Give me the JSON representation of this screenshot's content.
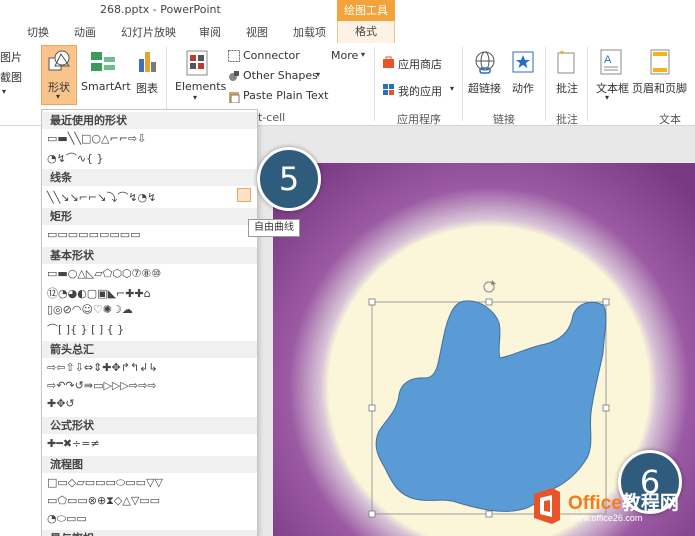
{
  "window": {
    "title": "268.pptx - PowerPoint",
    "contextual_tab_group": "绘图工具"
  },
  "tabs": [
    "切换",
    "动画",
    "幻灯片放映",
    "审阅",
    "视图",
    "加载项",
    "格式"
  ],
  "ribbon": {
    "picture_partial": "图片",
    "screenshot_partial": "截图",
    "shapes": "形状",
    "smartart": "SmartArt",
    "chart": "图表",
    "elements": "Elements",
    "connector": "Connector",
    "other_shapes": "Other Shapes",
    "paste_plain_text": "Paste Plain Text",
    "more": "More",
    "group_partial": "t-cell",
    "app_store": "应用商店",
    "my_apps": "我的应用",
    "apps_group": "应用程序",
    "hyperlink": "超链接",
    "action": "动作",
    "links_group": "链接",
    "comment": "批注",
    "comments_group": "批注",
    "textbox": "文本框",
    "header_footer": "页眉和页脚",
    "text_group": "文本"
  },
  "dropdown": {
    "sections": [
      {
        "name": "最近使用的形状",
        "rows": [
          "▭▬╲╲□○△⌐⌐⇨⇩",
          "◔↯⌒∿{ }"
        ]
      },
      {
        "name": "线条",
        "rows": [
          "╲╲↘↘⌐⌐↘⤵⌒↯◔↯"
        ]
      },
      {
        "name": "矩形",
        "rows": [
          "▭▭▭▭▭▭▭▭▭"
        ]
      },
      {
        "name": "基本形状",
        "rows": [
          "▭▬○△◺▱⬠⬡⬡⑦⑧⑩",
          "⑫◔◕◐▢▣◣⌐✚✚⌂",
          "▯◎⊘◠☺♡✺☽☁",
          "⌒[ ]{ } [ ] { }"
        ]
      },
      {
        "name": "箭头总汇",
        "rows": [
          "⇨⇦⇧⇩⇔⇕✚✥↱↰↲↳",
          "⇨↶↷↺⇛▭▷▷▷⇨⇨⇨",
          "✚✥↺"
        ]
      },
      {
        "name": "公式形状",
        "rows": [
          "✚━✖÷=≠"
        ]
      },
      {
        "name": "流程图",
        "rows": [
          "□▭◇▱▭▭▭⬭▭▭▽▽",
          "▭⬠▭▭⊗⊕⧗◇△▽▭▭",
          "◔⬭▭▭"
        ]
      }
    ],
    "last_section_partial": "星与旗帜"
  },
  "tooltip": "自由曲线",
  "callouts": [
    "5",
    "6"
  ],
  "watermark": {
    "brand_latin": "Office",
    "brand_cn": "教程网",
    "url": "www.office26.com"
  }
}
